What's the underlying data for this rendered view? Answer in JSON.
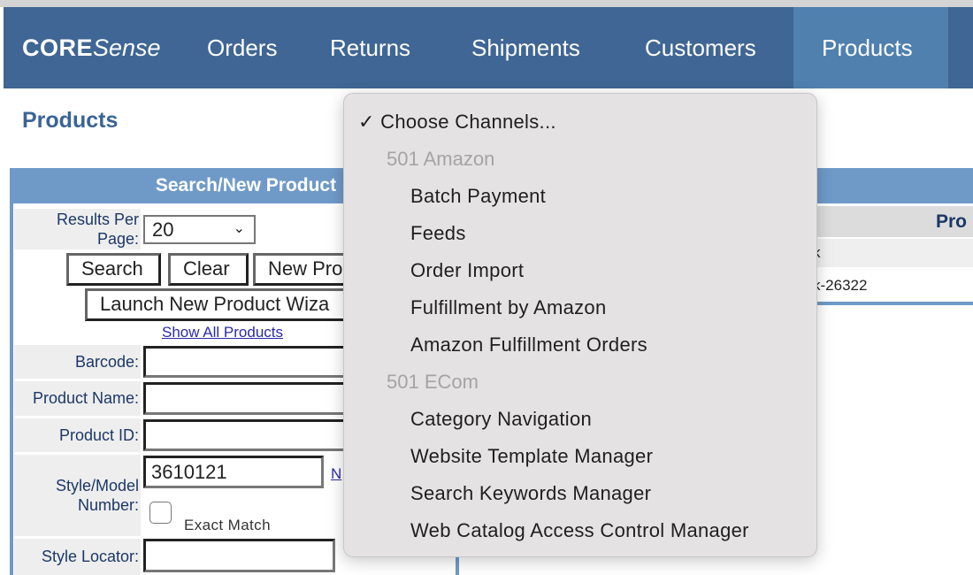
{
  "nav": {
    "logo_bold": "CORE",
    "logo_italic": "Sense",
    "items": [
      {
        "label": "Orders"
      },
      {
        "label": "Returns"
      },
      {
        "label": "Shipments"
      },
      {
        "label": "Customers"
      },
      {
        "label": "Products",
        "active": true
      }
    ]
  },
  "colors": {
    "nav_bg": "#3f6694",
    "nav_active": "#4f80ae",
    "panel_header": "#6f9ac8",
    "title": "#3a6494"
  },
  "page": {
    "title": "Products"
  },
  "search_panel": {
    "title": "Search/New Product",
    "results_per_page_label": "Results Per Page:",
    "results_per_page_value": "20",
    "search_button": "Search",
    "clear_button": "Clear",
    "new_product_button": "New Pro",
    "wizard_button": "Launch New Product Wiza",
    "show_all_link": "Show All Products",
    "barcode_label": "Barcode:",
    "barcode_value": "",
    "product_name_label": "Product Name:",
    "product_name_value": "",
    "product_id_label": "Product ID:",
    "product_id_value": "",
    "style_label": "Style/Model Number:",
    "style_value": "3610121",
    "style_link": "N",
    "exact_match_label": "Exact Match",
    "exact_match_checked": false,
    "style_locator_label": "Style Locator:",
    "style_locator_value": ""
  },
  "results_panel": {
    "column_header": "Pro",
    "rows": [
      {
        "text": "k"
      },
      {
        "text": "k-26322"
      }
    ]
  },
  "channel_menu": {
    "selected": "Choose Channels...",
    "groups": [
      {
        "header": "501 Amazon",
        "items": [
          "Batch Payment",
          "Feeds",
          "Order Import",
          "Fulfillment by Amazon",
          "Amazon Fulfillment Orders"
        ]
      },
      {
        "header": "501 ECom",
        "items": [
          "Category Navigation",
          "Website Template Manager",
          "Search Keywords Manager",
          "Web Catalog Access Control Manager"
        ]
      }
    ]
  }
}
